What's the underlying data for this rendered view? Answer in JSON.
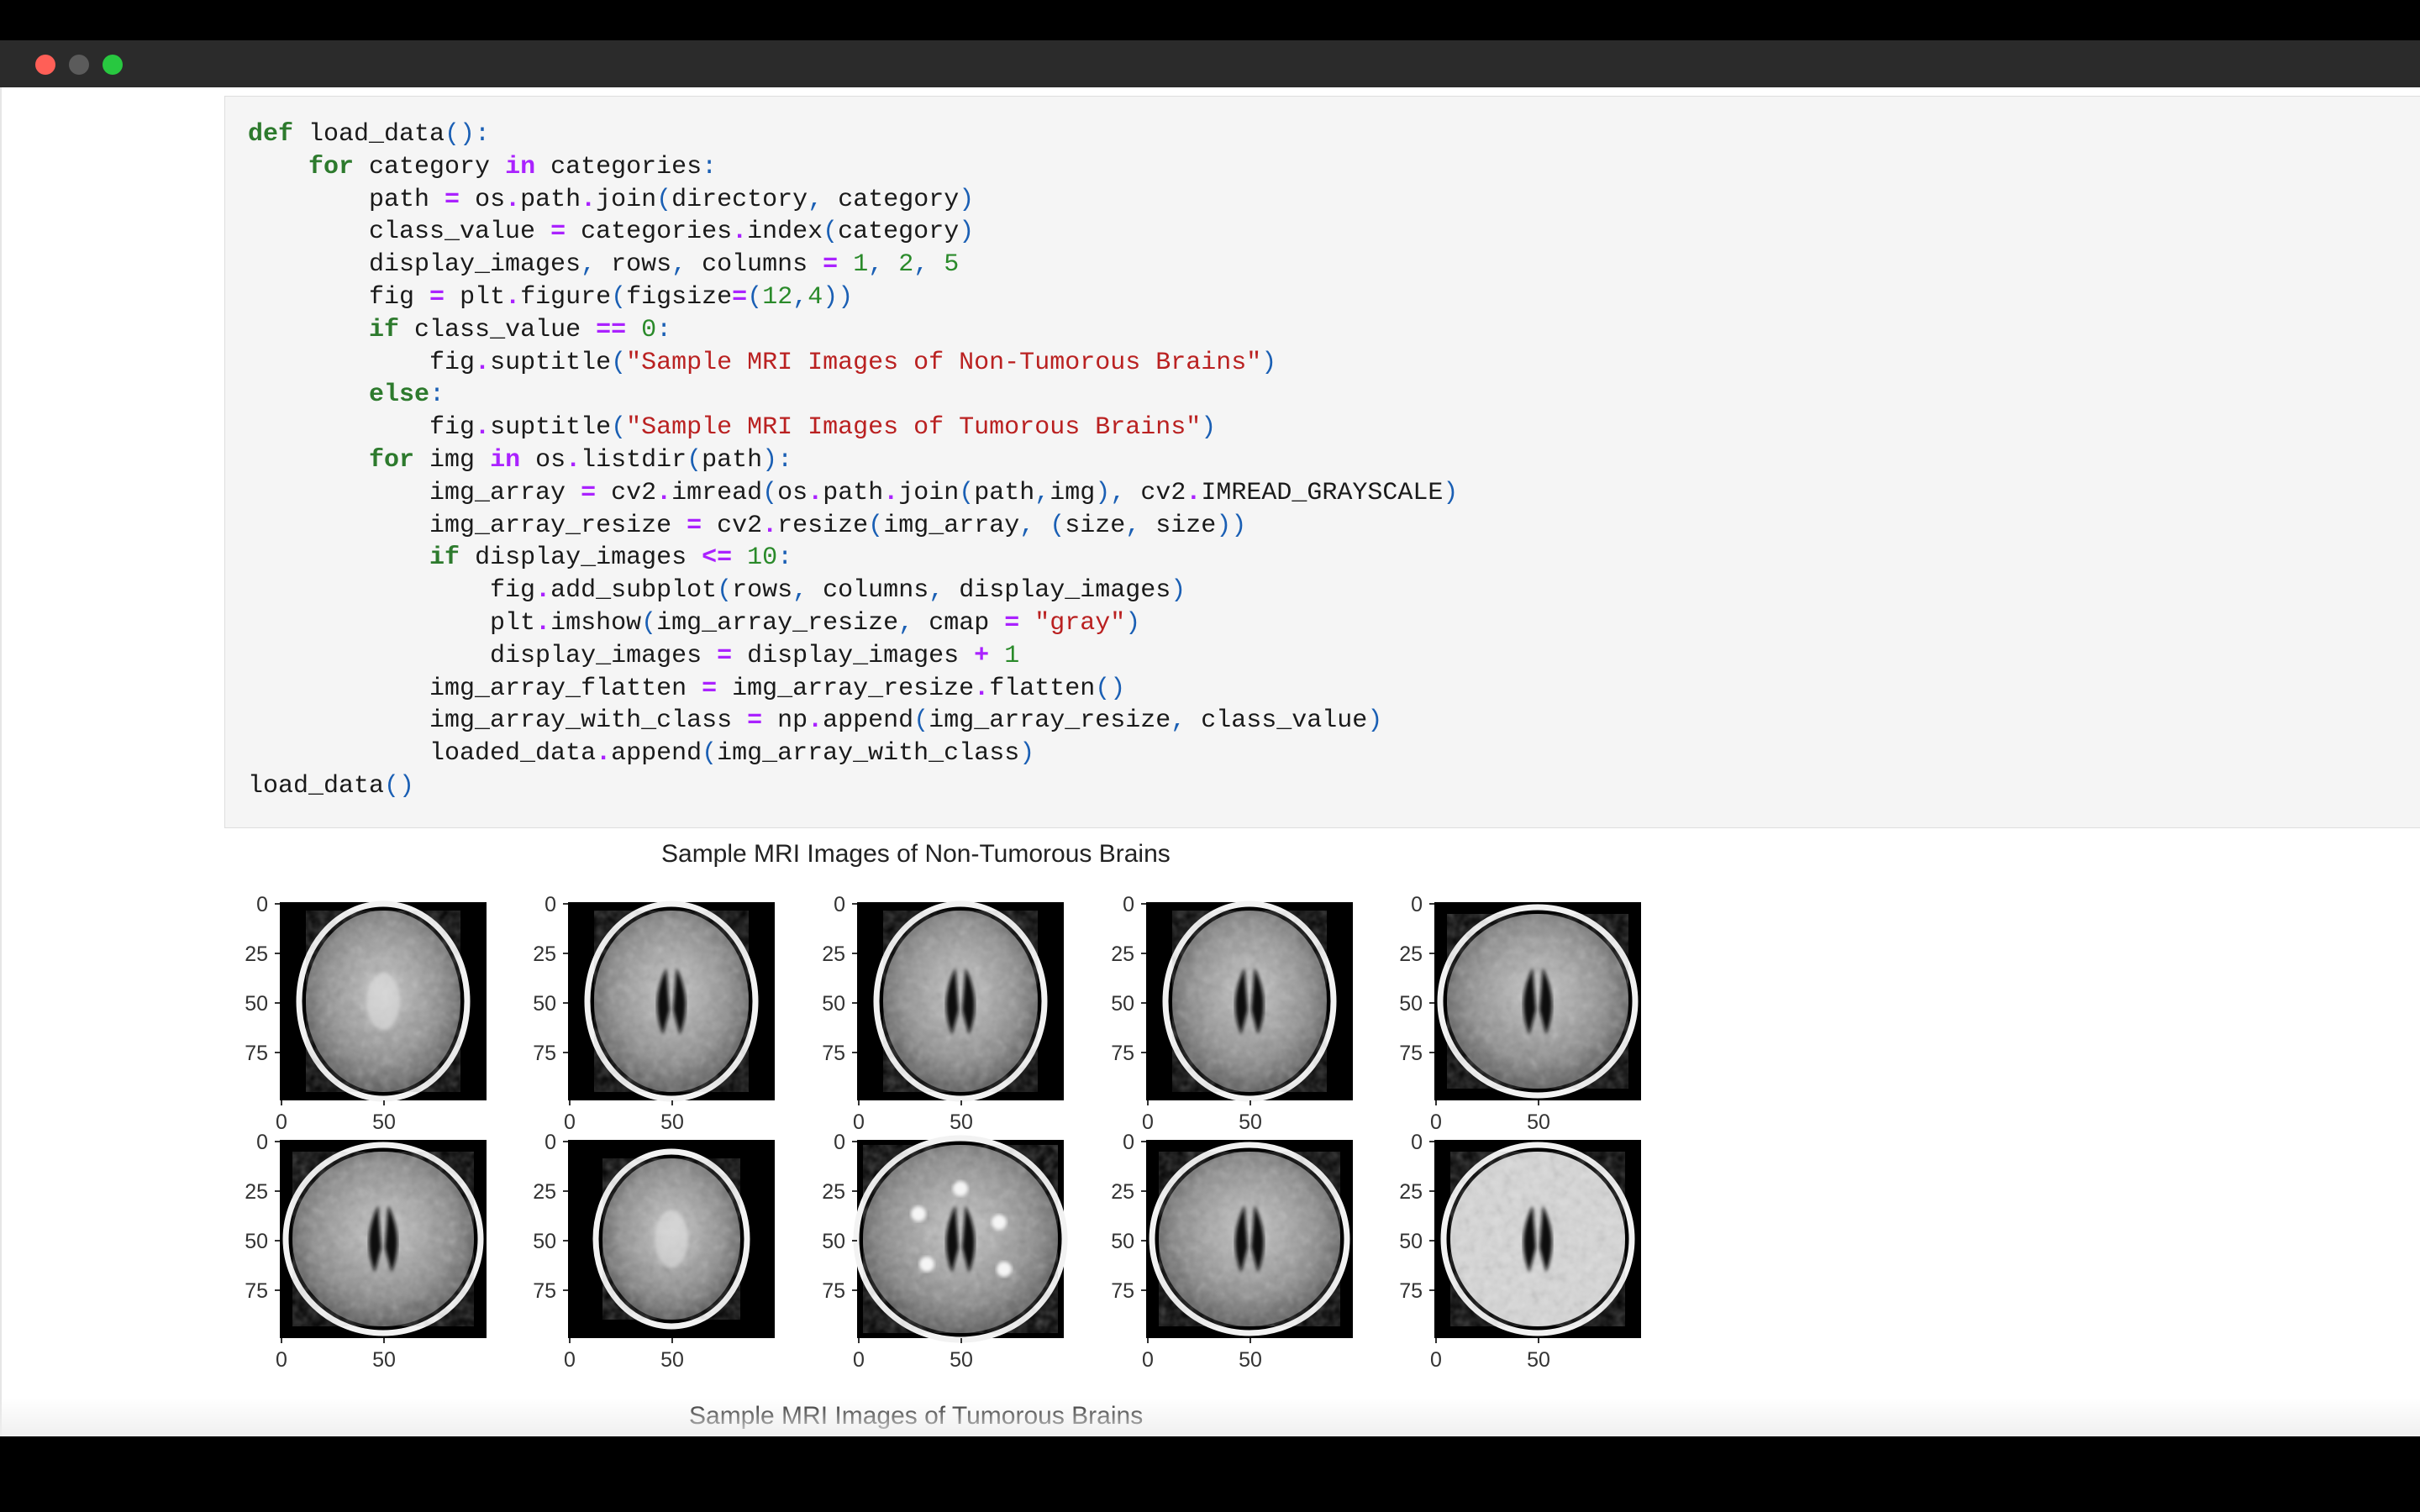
{
  "window": {
    "controls": [
      "close",
      "minimize",
      "zoom"
    ]
  },
  "code_lines": [
    [
      [
        "k",
        "def"
      ],
      [
        "t",
        " load_data"
      ],
      [
        "p",
        "():"
      ]
    ],
    [
      [
        "t",
        "    "
      ],
      [
        "k",
        "for"
      ],
      [
        "t",
        " category "
      ],
      [
        "o",
        "in"
      ],
      [
        "t",
        " categories"
      ],
      [
        "p",
        ":"
      ]
    ],
    [
      [
        "t",
        "        path "
      ],
      [
        "o",
        "="
      ],
      [
        "t",
        " os"
      ],
      [
        "o",
        "."
      ],
      [
        "t",
        "path"
      ],
      [
        "o",
        "."
      ],
      [
        "t",
        "join"
      ],
      [
        "p",
        "("
      ],
      [
        "t",
        "directory"
      ],
      [
        "p",
        ","
      ],
      [
        "t",
        " category"
      ],
      [
        "p",
        ")"
      ]
    ],
    [
      [
        "t",
        "        class_value "
      ],
      [
        "o",
        "="
      ],
      [
        "t",
        " categories"
      ],
      [
        "o",
        "."
      ],
      [
        "t",
        "index"
      ],
      [
        "p",
        "("
      ],
      [
        "t",
        "category"
      ],
      [
        "p",
        ")"
      ]
    ],
    [
      [
        "t",
        "        display_images"
      ],
      [
        "p",
        ","
      ],
      [
        "t",
        " rows"
      ],
      [
        "p",
        ","
      ],
      [
        "t",
        " columns "
      ],
      [
        "o",
        "="
      ],
      [
        "t",
        " "
      ],
      [
        "n",
        "1"
      ],
      [
        "p",
        ","
      ],
      [
        "t",
        " "
      ],
      [
        "n",
        "2"
      ],
      [
        "p",
        ","
      ],
      [
        "t",
        " "
      ],
      [
        "n",
        "5"
      ]
    ],
    [
      [
        "t",
        "        fig "
      ],
      [
        "o",
        "="
      ],
      [
        "t",
        " plt"
      ],
      [
        "o",
        "."
      ],
      [
        "t",
        "figure"
      ],
      [
        "p",
        "("
      ],
      [
        "t",
        "figsize"
      ],
      [
        "o",
        "="
      ],
      [
        "p",
        "("
      ],
      [
        "n",
        "12"
      ],
      [
        "p",
        ","
      ],
      [
        "n",
        "4"
      ],
      [
        "p",
        "))"
      ]
    ],
    [
      [
        "t",
        "        "
      ],
      [
        "k",
        "if"
      ],
      [
        "t",
        " class_value "
      ],
      [
        "o",
        "=="
      ],
      [
        "t",
        " "
      ],
      [
        "n",
        "0"
      ],
      [
        "p",
        ":"
      ]
    ],
    [
      [
        "t",
        "            fig"
      ],
      [
        "o",
        "."
      ],
      [
        "t",
        "suptitle"
      ],
      [
        "p",
        "("
      ],
      [
        "s",
        "\"Sample MRI Images of Non-Tumorous Brains\""
      ],
      [
        "p",
        ")"
      ]
    ],
    [
      [
        "t",
        "        "
      ],
      [
        "k",
        "else"
      ],
      [
        "p",
        ":"
      ]
    ],
    [
      [
        "t",
        "            fig"
      ],
      [
        "o",
        "."
      ],
      [
        "t",
        "suptitle"
      ],
      [
        "p",
        "("
      ],
      [
        "s",
        "\"Sample MRI Images of Tumorous Brains\""
      ],
      [
        "p",
        ")"
      ]
    ],
    [
      [
        "t",
        "        "
      ],
      [
        "k",
        "for"
      ],
      [
        "t",
        " img "
      ],
      [
        "o",
        "in"
      ],
      [
        "t",
        " os"
      ],
      [
        "o",
        "."
      ],
      [
        "t",
        "listdir"
      ],
      [
        "p",
        "("
      ],
      [
        "t",
        "path"
      ],
      [
        "p",
        "):"
      ]
    ],
    [
      [
        "t",
        "            img_array "
      ],
      [
        "o",
        "="
      ],
      [
        "t",
        " cv2"
      ],
      [
        "o",
        "."
      ],
      [
        "t",
        "imread"
      ],
      [
        "p",
        "("
      ],
      [
        "t",
        "os"
      ],
      [
        "o",
        "."
      ],
      [
        "t",
        "path"
      ],
      [
        "o",
        "."
      ],
      [
        "t",
        "join"
      ],
      [
        "p",
        "("
      ],
      [
        "t",
        "path"
      ],
      [
        "p",
        ","
      ],
      [
        "t",
        "img"
      ],
      [
        "p",
        "),"
      ],
      [
        "t",
        " cv2"
      ],
      [
        "o",
        "."
      ],
      [
        "t",
        "IMREAD_GRAYSCALE"
      ],
      [
        "p",
        ")"
      ]
    ],
    [
      [
        "t",
        "            img_array_resize "
      ],
      [
        "o",
        "="
      ],
      [
        "t",
        " cv2"
      ],
      [
        "o",
        "."
      ],
      [
        "t",
        "resize"
      ],
      [
        "p",
        "("
      ],
      [
        "t",
        "img_array"
      ],
      [
        "p",
        ","
      ],
      [
        "t",
        " "
      ],
      [
        "p",
        "("
      ],
      [
        "t",
        "size"
      ],
      [
        "p",
        ","
      ],
      [
        "t",
        " size"
      ],
      [
        "p",
        "))"
      ]
    ],
    [
      [
        "t",
        "            "
      ],
      [
        "k",
        "if"
      ],
      [
        "t",
        " display_images "
      ],
      [
        "o",
        "<="
      ],
      [
        "t",
        " "
      ],
      [
        "n",
        "10"
      ],
      [
        "p",
        ":"
      ]
    ],
    [
      [
        "t",
        "                fig"
      ],
      [
        "o",
        "."
      ],
      [
        "t",
        "add_subplot"
      ],
      [
        "p",
        "("
      ],
      [
        "t",
        "rows"
      ],
      [
        "p",
        ","
      ],
      [
        "t",
        " columns"
      ],
      [
        "p",
        ","
      ],
      [
        "t",
        " display_images"
      ],
      [
        "p",
        ")"
      ]
    ],
    [
      [
        "t",
        "                plt"
      ],
      [
        "o",
        "."
      ],
      [
        "t",
        "imshow"
      ],
      [
        "p",
        "("
      ],
      [
        "t",
        "img_array_resize"
      ],
      [
        "p",
        ","
      ],
      [
        "t",
        " cmap "
      ],
      [
        "o",
        "="
      ],
      [
        "t",
        " "
      ],
      [
        "s",
        "\"gray\""
      ],
      [
        "p",
        ")"
      ]
    ],
    [
      [
        "t",
        "                display_images "
      ],
      [
        "o",
        "="
      ],
      [
        "t",
        " display_images "
      ],
      [
        "o",
        "+"
      ],
      [
        "t",
        " "
      ],
      [
        "n",
        "1"
      ]
    ],
    [
      [
        "t",
        "            img_array_flatten "
      ],
      [
        "o",
        "="
      ],
      [
        "t",
        " img_array_resize"
      ],
      [
        "o",
        "."
      ],
      [
        "t",
        "flatten"
      ],
      [
        "p",
        "()"
      ]
    ],
    [
      [
        "t",
        "            img_array_with_class "
      ],
      [
        "o",
        "="
      ],
      [
        "t",
        " np"
      ],
      [
        "o",
        "."
      ],
      [
        "t",
        "append"
      ],
      [
        "p",
        "("
      ],
      [
        "t",
        "img_array_resize"
      ],
      [
        "p",
        ","
      ],
      [
        "t",
        " class_value"
      ],
      [
        "p",
        ")"
      ]
    ],
    [
      [
        "t",
        "            loaded_data"
      ],
      [
        "o",
        "."
      ],
      [
        "t",
        "append"
      ],
      [
        "p",
        "("
      ],
      [
        "t",
        "img_array_with_class"
      ],
      [
        "p",
        ")"
      ]
    ],
    [
      [
        "t",
        "load_data"
      ],
      [
        "p",
        "()"
      ]
    ]
  ],
  "output": {
    "suptitle_non_tumorous": "Sample MRI Images of Non-Tumorous Brains",
    "suptitle_tumorous": "Sample MRI Images of Tumorous Brains",
    "subplot_rows": 2,
    "subplot_columns": 5,
    "y_tick_labels": [
      "0",
      "25",
      "50",
      "75"
    ],
    "x_tick_labels": [
      "0",
      "50"
    ],
    "image_variants": [
      "round",
      "round-ventricles",
      "round-textured",
      "round-ventricles",
      "oval-dark",
      "oval-textured",
      "round-small",
      "round-wm-lesions",
      "oval-ventricles",
      "t2-bright"
    ]
  }
}
